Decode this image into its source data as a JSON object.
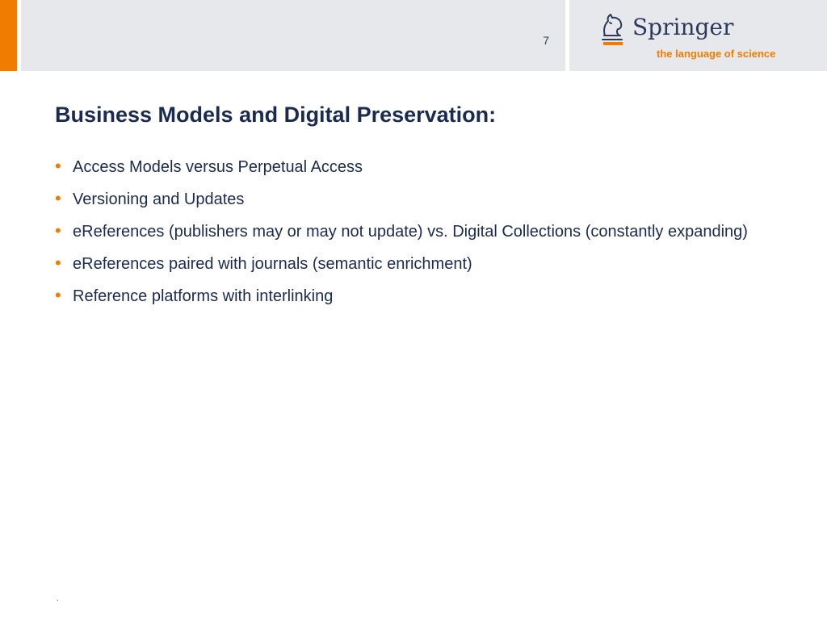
{
  "header": {
    "page_number": "7",
    "logo": {
      "name": "Springer",
      "tagline": "the language of science"
    }
  },
  "slide": {
    "title": "Business Models and Digital Preservation:",
    "bullets": [
      "Access Models versus Perpetual Access",
      "Versioning and Updates",
      "eReferences  (publishers may or may not update) vs. Digital Collections (constantly expanding)",
      "eReferences paired with journals (semantic enrichment)",
      "Reference platforms with interlinking"
    ],
    "bullet_symbol": "•"
  },
  "footer": {
    "mark": "."
  },
  "colors": {
    "accent": "#f07d00",
    "navy": "#1b2b50",
    "header_band": "#e7e8ec"
  },
  "icons": {
    "logo_mark": "chess-knight-icon"
  }
}
